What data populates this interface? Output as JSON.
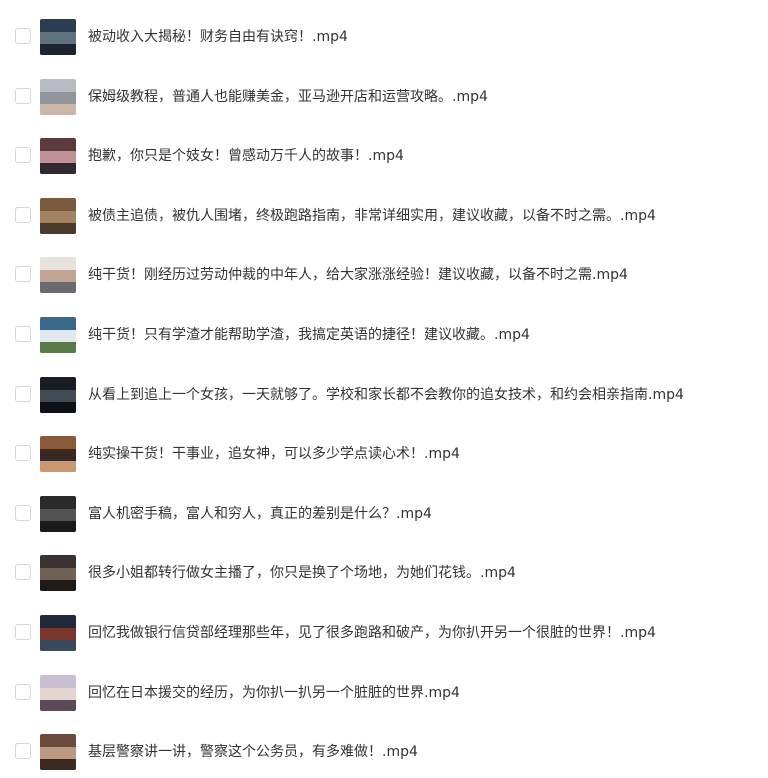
{
  "files": [
    {
      "name": "被动收入大揭秘！财务自由有诀窍！.mp4",
      "thumb_colors": [
        "#2a3d52",
        "#6a7a88",
        "#1c2430"
      ]
    },
    {
      "name": "保姆级教程，普通人也能赚美金，亚马逊开店和运营攻略。.mp4",
      "thumb_colors": [
        "#b8bcc2",
        "#8a8f96",
        "#c9b6a8"
      ]
    },
    {
      "name": "抱歉，你只是个妓女！曾感动万千人的故事！.mp4",
      "thumb_colors": [
        "#5a3a3a",
        "#d2a0a8",
        "#2e2a30"
      ]
    },
    {
      "name": "被债主追债，被仇人围堵，终极跑路指南，非常详细实用，建议收藏，以备不时之需。.mp4",
      "thumb_colors": [
        "#7a5a3c",
        "#a88a6a",
        "#4a3a2c"
      ]
    },
    {
      "name": "纯干货！刚经历过劳动仲裁的中年人，给大家涨涨经验！建议收藏，以备不时之需.mp4",
      "thumb_colors": [
        "#e8e2dc",
        "#b89a88",
        "#6a6a70"
      ]
    },
    {
      "name": "纯干货！只有学渣才能帮助学渣，我搞定英语的捷径！建议收藏。.mp4",
      "thumb_colors": [
        "#3a6a8a",
        "#ffffff",
        "#5a7a4a"
      ]
    },
    {
      "name": "从看上到追上一个女孩，一天就够了。学校和家长都不会教你的追女技术，和约会相亲指南.mp4",
      "thumb_colors": [
        "#1a1e24",
        "#4a525c",
        "#0e1014"
      ]
    },
    {
      "name": "纯实操干货！干事业，追女神，可以多少学点读心术！.mp4",
      "thumb_colors": [
        "#8a5a3a",
        "#2a2020",
        "#c89870"
      ]
    },
    {
      "name": "富人机密手稿，富人和穷人，真正的差别是什么？.mp4",
      "thumb_colors": [
        "#2a2a2a",
        "#5a5a5a",
        "#1a1a1a"
      ]
    },
    {
      "name": "很多小姐都转行做女主播了，你只是换了个场地，为她们花钱。.mp4",
      "thumb_colors": [
        "#3a3230",
        "#7a6a5a",
        "#1e1a18"
      ]
    },
    {
      "name": "回忆我做银行信贷部经理那些年，见了很多跑路和破产，为你扒开另一个很脏的世界！.mp4",
      "thumb_colors": [
        "#1e2a3a",
        "#8a3a2a",
        "#3a4a5a"
      ]
    },
    {
      "name": "回忆在日本援交的经历，为你扒一扒另一个脏脏的世界.mp4",
      "thumb_colors": [
        "#c8c0d0",
        "#e8d8d0",
        "#5a4a5a"
      ]
    },
    {
      "name": "基层警察讲一讲，警察这个公务员，有多难做！.mp4",
      "thumb_colors": [
        "#6a4a3a",
        "#c8a890",
        "#3a2a22"
      ]
    }
  ]
}
